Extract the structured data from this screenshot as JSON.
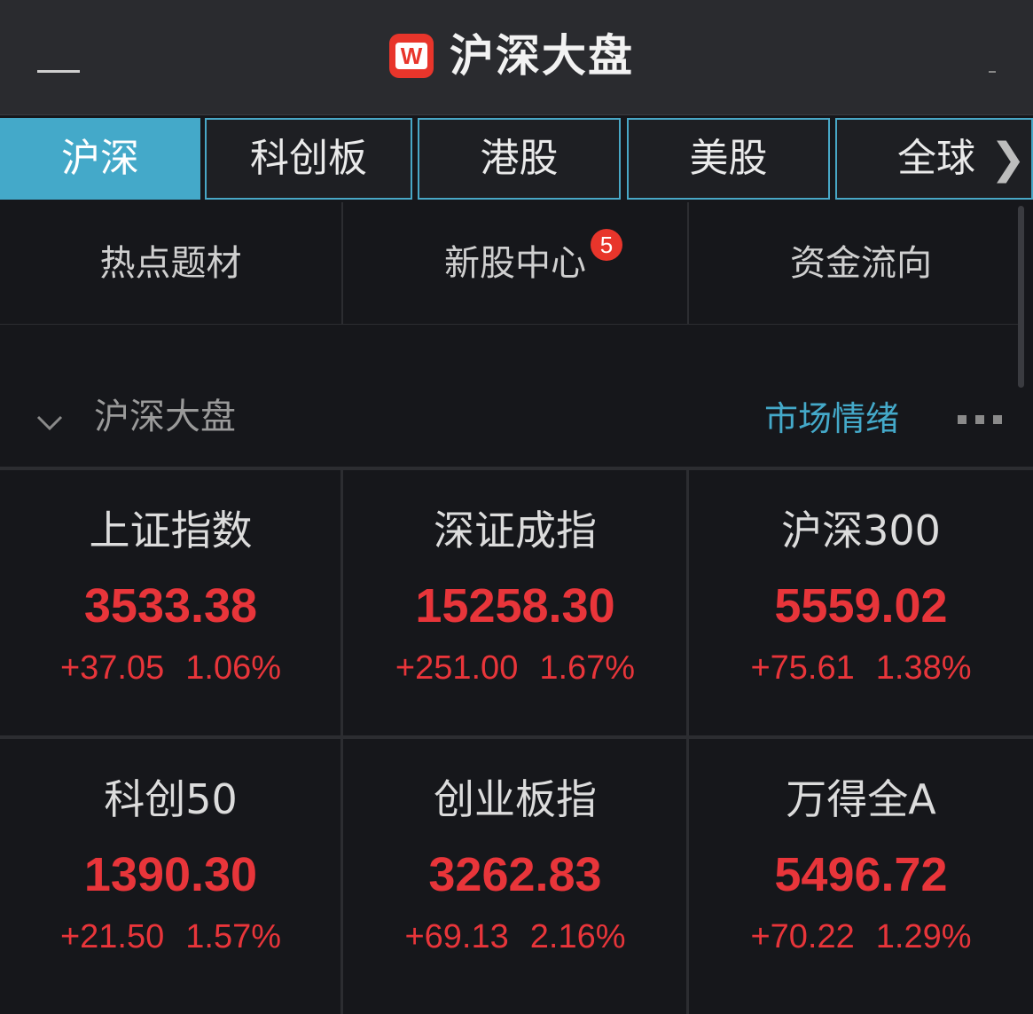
{
  "header": {
    "title": "沪深大盘",
    "logo_letter": "W",
    "back_icon": "back-icon",
    "logo_color": "#e8352b"
  },
  "tabs": [
    {
      "label": "沪深",
      "active": true
    },
    {
      "label": "科创板",
      "active": false
    },
    {
      "label": "港股",
      "active": false
    },
    {
      "label": "美股",
      "active": false
    },
    {
      "label": "全球",
      "active": false
    }
  ],
  "quicknav": [
    {
      "label": "热点题材"
    },
    {
      "label": "新股中心",
      "badge": "5"
    },
    {
      "label": "资金流向"
    }
  ],
  "section": {
    "title": "沪深大盘",
    "link": "市场情绪",
    "more_icon": "more-icon"
  },
  "indices": [
    {
      "name": "上证指数",
      "price": "3533.38",
      "change": "+37.05",
      "pct": "1.06%"
    },
    {
      "name": "深证成指",
      "price": "15258.30",
      "change": "+251.00",
      "pct": "1.67%"
    },
    {
      "name": "沪深300",
      "price": "5559.02",
      "change": "+75.61",
      "pct": "1.38%"
    },
    {
      "name": "科创50",
      "price": "1390.30",
      "change": "+21.50",
      "pct": "1.57%"
    },
    {
      "name": "创业板指",
      "price": "3262.83",
      "change": "+69.13",
      "pct": "2.16%"
    },
    {
      "name": "万得全A",
      "price": "5496.72",
      "change": "+70.22",
      "pct": "1.29%"
    }
  ],
  "colors": {
    "accent": "#44a9c9",
    "up": "#e8353a",
    "background": "#16171b"
  }
}
